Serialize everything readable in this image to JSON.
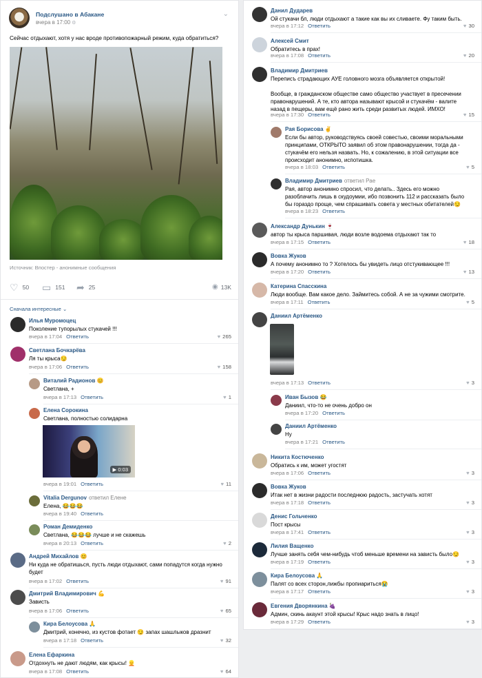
{
  "post": {
    "author": "Подслушано в Абакане",
    "time": "вчера в 17:00",
    "text": "Сейчас отдыхают, хотя у нас вроде противопожарный режим, куда обратиться?",
    "source": "Источник: Впостер - анонимные сообщения",
    "likes": "50",
    "comments": "151",
    "shares": "25",
    "views": "13K"
  },
  "sort_label": "Сначала интересные",
  "reply_label": "Ответить",
  "left_comments": [
    {
      "name": "Илья Муромоцец",
      "text": "Поколение тупорылых стукачей !!!",
      "time": "вчера в 17:04",
      "likes": "265",
      "avatar_color": "#2b2b2b"
    },
    {
      "name": "Светлана Бочкарёва",
      "text": "Ля ты крыса😏",
      "time": "вчера в 17:06",
      "likes": "158",
      "avatar_color": "#a0306a"
    },
    {
      "name": "Виталий Радионов 😊",
      "text": "Светлана, +",
      "time": "вчера в 17:13",
      "likes": "1",
      "avatar_color": "#b79a86"
    },
    {
      "name": "Елена Сорокина",
      "text": "Светлана, полностью солидарна",
      "time": "вчера в 19:01",
      "likes": "11",
      "avatar_color": "#c86a4a"
    },
    {
      "name": "Vitalia Dergunov",
      "to": "ответил Елене",
      "text": "Елена, 😂😂😂",
      "time": "вчера в 19:40",
      "likes": "",
      "avatar_color": "#6b6d3a"
    },
    {
      "name": "Роман Демиденко",
      "text": "Светлана, 😂😂😂 лучше и не скажешь",
      "time": "вчера в 20:13",
      "likes": "2",
      "avatar_color": "#7a8c5a"
    },
    {
      "name": "Андрей Михайлов 😊",
      "text": "Ни куда не обратишься, пусть люди отдыхают, сами попадутся когда нужно будет",
      "time": "вчера в 17:02",
      "likes": "91",
      "avatar_color": "#5a6b86"
    },
    {
      "name": "Дмитрий Владимирович 💪",
      "text": "Зависть",
      "time": "вчера в 17:06",
      "likes": "65",
      "avatar_color": "#4c4c4c"
    },
    {
      "name": "Кира Белоусова 🙏",
      "text": "Дмитрий, конечно, из кустов фотает 😏 запах шашлыков дразнит",
      "time": "вчера в 17:18",
      "likes": "32",
      "avatar_color": "#7d8f9c"
    },
    {
      "name": "Елена Ефаркина",
      "text": "Отдохнуть не дают людям, как крысы! 👱",
      "time": "вчера в 17:08",
      "likes": "64",
      "avatar_color": "#c99a8a"
    }
  ],
  "right_comments": [
    {
      "name": "Данил Дударев",
      "text": "Ой стукачи бл, люди отдыхают а такие как вы их сливаете. Фу таким быть.",
      "time": "вчера в 17:12",
      "likes": "30",
      "avatar_color": "#333333"
    },
    {
      "name": "Алексей Смит",
      "text": "Обратитесь в прах!",
      "time": "вчера в 17:08",
      "likes": "20",
      "avatar_color": "#cdd4dc"
    },
    {
      "name": "Владимир Дмитриев",
      "text": "Переписъ страдающих АУЕ головного мозга объявляется открытой!\n\nВообще, в гражданском обществе само общество участвует в пресечении правонарушений. А те, кто автора называют крысой и стукачём - валите назад в пещеры, вам ещё рано жить среди развитых людей. ИМХО!",
      "time": "вчера в 17:30",
      "likes": "15",
      "avatar_color": "#2f2f2f"
    },
    {
      "name": "Рая Борисова ✌",
      "text": "Если бы автор, руководствуясь своей совестью, своими моральными принципами, ОТКРЫТО заявил об этом правонарушении, тогда да - стукачём его нельзя назвать. Но, к сожалению, в этой ситуации все происходит анонимно, испотишка.",
      "time": "вчера в 18:03",
      "likes": "5",
      "avatar_color": "#a07a6a"
    },
    {
      "name": "Владимир Дмитриев",
      "to": "ответил Рае",
      "text": "Рая, автор анонимно спросил, что делать.. Здесь его можно разоблачить лишь в скудоумии, ибо позвонить 112 и рассказать было бы гораздо проще, чем спрашивать совета у местных обитателей😏",
      "time": "вчера в 18:23",
      "likes": "",
      "avatar_color": "#2f2f2f"
    },
    {
      "name": "Александр Дунькин 🍷",
      "text": "автор ты крыса паршивая, люди возле водоема отдыхают так то",
      "time": "вчера в 17:15",
      "likes": "18",
      "avatar_color": "#5a5a5a"
    },
    {
      "name": "Вовка Жуков",
      "text": "А почему анонимно то ? Хотелось бы увидеть лицо отстукивающее !!!",
      "time": "вчера в 17:20",
      "likes": "13",
      "avatar_color": "#2b2b2b"
    },
    {
      "name": "Катерина Спасскина",
      "text": "Люди вообще. Вам какое дело. Займитесь собой. А не за чужими смотрите.",
      "time": "вчера в 17:11",
      "likes": "5",
      "avatar_color": "#d6b8a8"
    },
    {
      "name": "Даниил Артёменко",
      "text": "",
      "time": "вчера в 17:13",
      "likes": "3",
      "avatar_color": "#444444"
    },
    {
      "name": "Иван Бызов 😂",
      "text": "Даниил, что-то не очень добро он",
      "time": "вчера в 17:20",
      "likes": "",
      "avatar_color": "#8a3a4a"
    },
    {
      "name": "Даниил Артёменко",
      "text": "Ну",
      "time": "вчера в 17:21",
      "likes": "",
      "avatar_color": "#444444"
    },
    {
      "name": "Никита Костюченко",
      "text": "Обратись к им, может угостят",
      "time": "вчера в 17:06",
      "likes": "3",
      "avatar_color": "#c9b79a"
    },
    {
      "name": "Вовка Жуков",
      "text": "Итак нет в жизни радости последнюю радость, застучать хотят",
      "time": "вчера в 17:18",
      "likes": "3",
      "avatar_color": "#2b2b2b"
    },
    {
      "name": "Денис Гольченко",
      "text": "Пост крысы",
      "time": "вчера в 17:41",
      "likes": "3",
      "avatar_color": "#d9d9d9"
    },
    {
      "name": "Лилия Ващенко",
      "text": "Лучше занять себя чем-нибудь чтоб меньше времени на зависть было😏",
      "time": "вчера в 17:19",
      "likes": "3",
      "avatar_color": "#1c2a3a"
    },
    {
      "name": "Кира Белоусова 🙏",
      "text": "Палят со всех сторон,лижбы пропиариться😭",
      "time": "вчера в 17:17",
      "likes": "3",
      "avatar_color": "#7d8f9c"
    },
    {
      "name": "Евгения Дворянкина 🍇",
      "text": "Админ, скинь акаунт этой крысы! Крыс надо знать в лицо!",
      "time": "вчера в 17:29",
      "likes": "3",
      "avatar_color": "#6a2a3a"
    }
  ],
  "video_duration": "0:03"
}
